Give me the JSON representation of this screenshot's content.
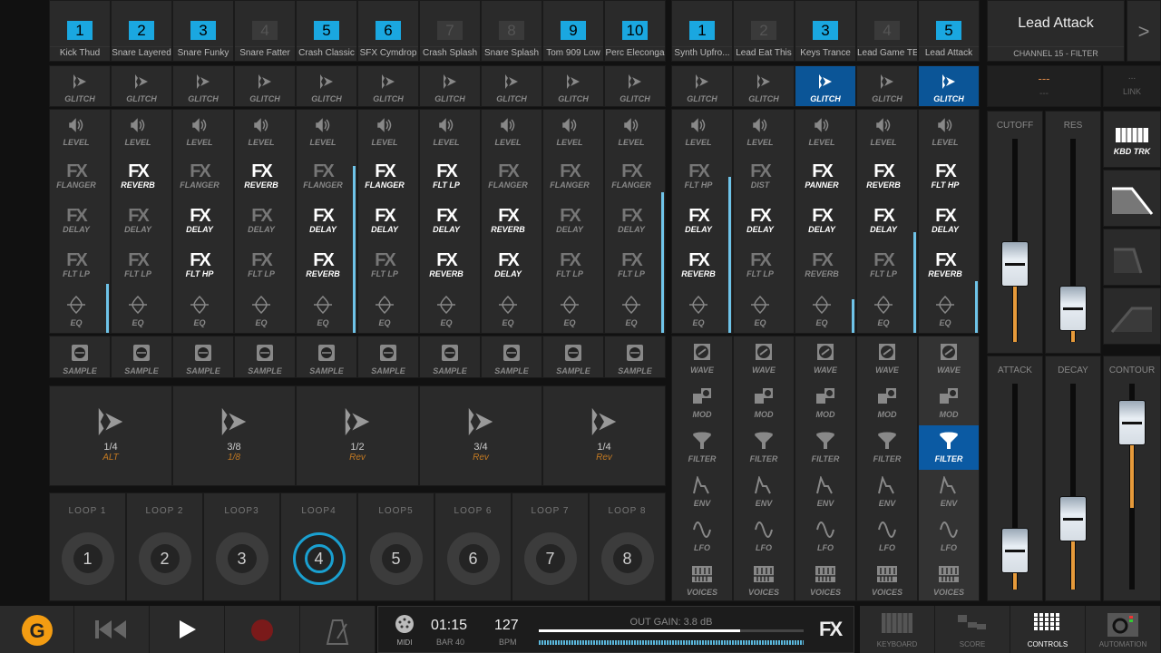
{
  "drums": [
    {
      "n": "1",
      "name": "Kick Thud",
      "on": true,
      "fx": [
        "FLANGER",
        "DELAY",
        "FLT LP"
      ],
      "fxon": [
        false,
        false,
        false
      ],
      "meter": 0.22
    },
    {
      "n": "2",
      "name": "Snare Layered",
      "on": true,
      "fx": [
        "REVERB",
        "DELAY",
        "FLT LP"
      ],
      "fxon": [
        true,
        false,
        false
      ],
      "meter": 0
    },
    {
      "n": "3",
      "name": "Snare Funky",
      "on": true,
      "fx": [
        "FLANGER",
        "DELAY",
        "FLT HP"
      ],
      "fxon": [
        false,
        true,
        true
      ],
      "meter": 0
    },
    {
      "n": "4",
      "name": "Snare Fatter",
      "on": false,
      "fx": [
        "REVERB",
        "DELAY",
        "FLT LP"
      ],
      "fxon": [
        true,
        false,
        false
      ],
      "meter": 0
    },
    {
      "n": "5",
      "name": "Crash Classic",
      "on": true,
      "fx": [
        "FLANGER",
        "DELAY",
        "REVERB"
      ],
      "fxon": [
        false,
        true,
        true
      ],
      "meter": 0.75
    },
    {
      "n": "6",
      "name": "SFX Cymdrop",
      "on": true,
      "fx": [
        "FLANGER",
        "DELAY",
        "FLT LP"
      ],
      "fxon": [
        true,
        true,
        false
      ],
      "meter": 0
    },
    {
      "n": "7",
      "name": "Crash Splash",
      "on": false,
      "fx": [
        "FLT LP",
        "DELAY",
        "REVERB"
      ],
      "fxon": [
        true,
        true,
        true
      ],
      "meter": 0
    },
    {
      "n": "8",
      "name": "Snare Splash",
      "on": false,
      "fx": [
        "FLANGER",
        "REVERB",
        "DELAY"
      ],
      "fxon": [
        false,
        true,
        true
      ],
      "meter": 0
    },
    {
      "n": "9",
      "name": "Tom 909 Low",
      "on": true,
      "fx": [
        "FLANGER",
        "DELAY",
        "FLT LP"
      ],
      "fxon": [
        false,
        false,
        false
      ],
      "meter": 0
    },
    {
      "n": "10",
      "name": "Perc Eleconga",
      "on": true,
      "fx": [
        "FLANGER",
        "DELAY",
        "FLT LP"
      ],
      "fxon": [
        false,
        false,
        false
      ],
      "meter": 0.63
    }
  ],
  "synths": [
    {
      "n": "1",
      "name": "Synth Upfro...",
      "on": true,
      "glitch": false,
      "fx": [
        "FLT HP",
        "DELAY",
        "REVERB"
      ],
      "fxon": [
        false,
        true,
        true
      ],
      "meter": 0.7
    },
    {
      "n": "2",
      "name": "Lead Eat This",
      "on": false,
      "glitch": false,
      "fx": [
        "DIST",
        "DELAY",
        "FLT LP"
      ],
      "fxon": [
        false,
        true,
        false
      ],
      "meter": 0
    },
    {
      "n": "3",
      "name": "Keys Trance",
      "on": true,
      "glitch": true,
      "fx": [
        "PANNER",
        "DELAY",
        "REVERB"
      ],
      "fxon": [
        true,
        true,
        false
      ],
      "meter": 0.15
    },
    {
      "n": "4",
      "name": "Lead Game TE",
      "on": false,
      "glitch": false,
      "fx": [
        "REVERB",
        "DELAY",
        "FLT LP"
      ],
      "fxon": [
        true,
        true,
        false
      ],
      "meter": 0.45
    },
    {
      "n": "5",
      "name": "Lead Attack",
      "on": true,
      "glitch": true,
      "fx": [
        "FLT HP",
        "DELAY",
        "REVERB"
      ],
      "fxon": [
        true,
        true,
        true
      ],
      "meter": 0.23
    }
  ],
  "labels": {
    "glitch": "GLITCH",
    "level": "LEVEL",
    "fx": "FX",
    "eq": "EQ",
    "sample": "SAMPLE",
    "synth_rows": [
      "WAVE",
      "MOD",
      "FILTER",
      "ENV",
      "LFO",
      "VOICES"
    ]
  },
  "selected_synth_row": {
    "channel": 5,
    "row": "FILTER"
  },
  "pads": [
    {
      "v": "1/4",
      "s": "ALT"
    },
    {
      "v": "3/8",
      "s": "1/8"
    },
    {
      "v": "1/2",
      "s": "Rev"
    },
    {
      "v": "3/4",
      "s": "Rev"
    },
    {
      "v": "1/4",
      "s": "Rev"
    }
  ],
  "loops": [
    {
      "t": "LOOP 1",
      "n": "1"
    },
    {
      "t": "LOOP 2",
      "n": "2"
    },
    {
      "t": "LOOP3",
      "n": "3"
    },
    {
      "t": "LOOP4",
      "n": "4",
      "on": true
    },
    {
      "t": "LOOP5",
      "n": "5"
    },
    {
      "t": "LOOP 6",
      "n": "6"
    },
    {
      "t": "LOOP 7",
      "n": "7"
    },
    {
      "t": "LOOP 8",
      "n": "8"
    }
  ],
  "panel": {
    "title": "Lead Attack",
    "subtitle": "CHANNEL 15 - FILTER",
    "next": ">",
    "value": "---",
    "value_sub": "---",
    "link_dots": "...",
    "link": "LINK",
    "kbd": "KBD TRK",
    "sliders": [
      {
        "label": "CUTOFF",
        "value": 0.35
      },
      {
        "label": "RES",
        "value": 0.07
      },
      {
        "label": "ATTACK",
        "value": 0.1
      },
      {
        "label": "DECAY",
        "value": 0.3
      },
      {
        "label": "CONTOUR",
        "value": 0.9
      }
    ]
  },
  "transport": {
    "time": "01:15",
    "bar": "BAR 40",
    "bpm": "127",
    "bpm_label": "BPM",
    "midi": "MIDI",
    "out_gain": "OUT GAIN: 3.8 dB",
    "gain_level": 0.76,
    "fx": "FX"
  },
  "views": [
    "KEYBOARD",
    "SCORE",
    "CONTROLS",
    "AUTOMATION"
  ],
  "colors": {
    "accent": "#1aa7e0",
    "selected": "#0b5597",
    "orange": "#e69a3a"
  }
}
